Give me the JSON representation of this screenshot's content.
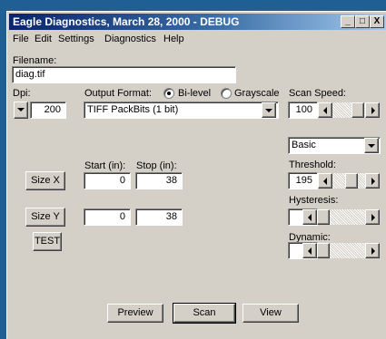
{
  "window": {
    "title": "Eagle Diagnostics, March 28, 2000 - DEBUG",
    "controls": {
      "minimize": "_",
      "maximize": "□",
      "close": "X"
    }
  },
  "menu": [
    "File",
    "Edit",
    "Settings",
    "Diagnostics",
    "Help"
  ],
  "filename": {
    "label": "Filename:",
    "value": "diag.tif"
  },
  "dpi": {
    "label": "Dpi:",
    "value": "200"
  },
  "output_format": {
    "label": "Output Format:",
    "options": [
      "Bi-level",
      "Grayscale"
    ],
    "selected": "Bi-level",
    "value": "TIFF PackBits (1 bit)"
  },
  "scan_speed": {
    "label": "Scan Speed:",
    "value": "100"
  },
  "mode_select": {
    "value": "Basic"
  },
  "threshold": {
    "label": "Threshold:",
    "value": "195"
  },
  "hysteresis": {
    "label": "Hysteresis:",
    "value": "0"
  },
  "dynamic": {
    "label": "Dynamic:",
    "value": "0"
  },
  "range": {
    "start_label": "Start (in):",
    "stop_label": "Stop (in):"
  },
  "size_x": {
    "label": "Size X",
    "start": "0",
    "stop": "38"
  },
  "size_y": {
    "label": "Size Y",
    "start": "0",
    "stop": "38"
  },
  "test_button": "TEST",
  "footer": {
    "preview": "Preview",
    "scan": "Scan",
    "view": "View"
  }
}
